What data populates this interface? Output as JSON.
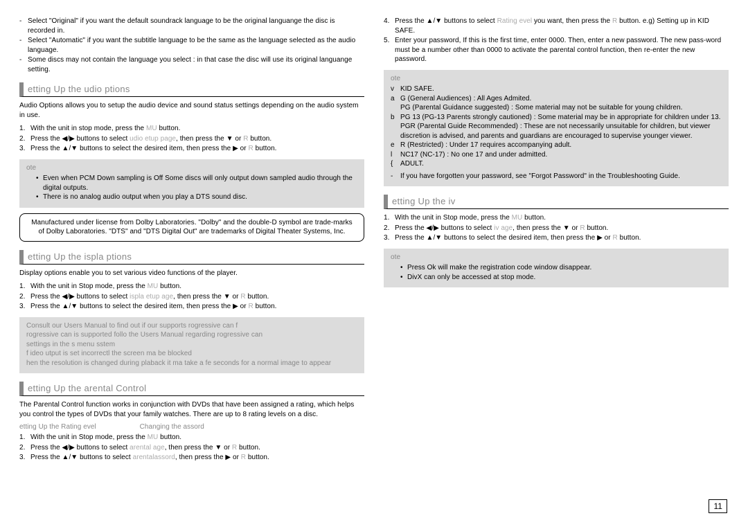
{
  "page_number": "11",
  "left": {
    "top_bullets": [
      "Select \"Original\" if you want the default soundrack language to be the original languange the disc is recorded in.",
      "Select \"Automatic\" if you want the subtitle language to be the same as the language selected as the audio language.",
      "Some discs may not contain the language you select : in that case the disc will use its original languange setting."
    ],
    "sec_audio": {
      "heading": "etting Up the udio ptions",
      "intro": "Audio Options allows you to setup the audio device and sound status settings depending on the audio system in use.",
      "steps": {
        "s1a": "With the unit in stop mode, press the ",
        "s1m": "MU",
        "s1b": " button.",
        "s2a": "Press the ◀/▶ buttons to select ",
        "s2m": "udio etup page",
        "s2b": ", then press the ▼ or ",
        "s2r": "R",
        "s2c": " button.",
        "s3a": "Press the ▲/▼ buttons to select the desired item, then press the ▶ or ",
        "s3r": "R",
        "s3b": " button."
      },
      "note_label": "ote",
      "note_items": [
        "Even when PCM Down sampling is Off Some discs will only output down sampled audio through the digital outputs.",
        "There is no analog audio output when you play a DTS sound disc."
      ],
      "legal": "Manufactured under license from Dolby Laboratories. \"Dolby\" and the double-D symbol are trade-marks of Dolby Laboratories. \"DTS\" and \"DTS Digital Out\" are trademarks of Digital Theater Systems, Inc."
    },
    "sec_display": {
      "heading": "etting Up the ispla ptions",
      "intro": "Display options enable you to set various video functions of the player.",
      "steps": {
        "s1a": "With the unit in Stop mode, press the ",
        "s1m": "MU",
        "s1b": " button.",
        "s2a": "Press the ◀/▶ buttons to select ",
        "s2m": "ispla etup age",
        "s2b": ", then press the ▼ or ",
        "s2r": "R",
        "s2c": " button.",
        "s3a": "Press the ▲/▼ buttons to select the desired item, then press the ▶ or ",
        "s3r": "R",
        "s3b": " button."
      },
      "note_lines": [
        "Consult our  Users Manual to find out if our  supports rogressive can f",
        "rogressive can is supported follo the  Users Manual regarding rogressive can",
        "settings in the s menu sstem",
        "f ideo utput is set incorrectl the screen ma be blocked",
        "hen the resolution is changed during plaback it ma take a fe seconds for a normal image to appear"
      ]
    },
    "sec_parental": {
      "heading": "etting Up the arental Control",
      "intro": "The Parental Control function works in conjunction with DVDs that have been assigned a rating, which helps you control the types of DVDs that your family watches. There are up to 8 rating levels on a disc.",
      "sub1": "etting Up the Rating evel",
      "sub2": "Changing the assord",
      "steps": {
        "s1a": "With the unit in Stop mode, press the ",
        "s1m": "MU",
        "s1b": " button.",
        "s2a": "Press the ◀/▶ buttons to select ",
        "s2m": "arental age",
        "s2b": ", then press the ▼ or ",
        "s2r": "R",
        "s2c": " button.",
        "s3a": "Press the ▲/▼ buttons to select ",
        "s3m": "arentalassord",
        "s3b": ", then press the ▶ or ",
        "s3r": "R",
        "s3c": " button."
      }
    }
  },
  "right": {
    "top_steps": {
      "s4a": "Press the ▲/▼ buttons to select ",
      "s4m": "Rating evel",
      "s4b": " you want, then press the ",
      "s4r": "R",
      "s4c": " button. e.g) Setting up in KID SAFE.",
      "s5": "Enter your password, If this is the first time, enter 0000. Then, enter a new password. The new pass-word must be a number other than 0000 to activate the parental control function, then re-enter the new password."
    },
    "note_label": "ote",
    "rating_rows": [
      {
        "m": "v",
        "t": "KID SAFE."
      },
      {
        "m": "a",
        "t": "G (General Audiences) : All Ages Admited."
      },
      {
        "m": "",
        "t": "PG (Parental Guidance suggested) : Some material may not be suitable for young children."
      },
      {
        "m": "b",
        "t": "PG 13 (PG-13 Parents strongly cautioned) : Some material may be in appropriate for children under 13."
      },
      {
        "m": "",
        "t": "PGR (Parental Guide Recommended) : These are not necessarily unsuitable for children, but viewer discretion is advised, and parents and guardians are encouraged to supervise younger viewer."
      },
      {
        "m": "e",
        "t": "R (Restricted) : Under 17 requires accompanying adult."
      },
      {
        "m": "l",
        "t": "NC17 (NC-17) : No one 17 and under admitted."
      },
      {
        "m": "{",
        "t": "ADULT."
      }
    ],
    "rating_footer": "If you have forgotten your password, see \"Forgot Password\" in the Troubleshooting Guide.",
    "sec_div": {
      "heading": "etting Up the iv",
      "steps": {
        "s1a": "With the unit in Stop mode, press the ",
        "s1m": "MU",
        "s1b": " button.",
        "s2a": "Press the ◀/▶ buttons to select ",
        "s2m": "iv age",
        "s2b": ", then press the ▼ or ",
        "s2r": "R",
        "s2c": " button.",
        "s3a": "Press the ▲/▼ buttons to select the desired item, then press the ▶ or ",
        "s3r": "R",
        "s3b": " button."
      },
      "note_label": "ote",
      "note_items": [
        "Press Ok will make the registration code window disappear.",
        "DivX can only be accessed at stop mode."
      ]
    }
  }
}
